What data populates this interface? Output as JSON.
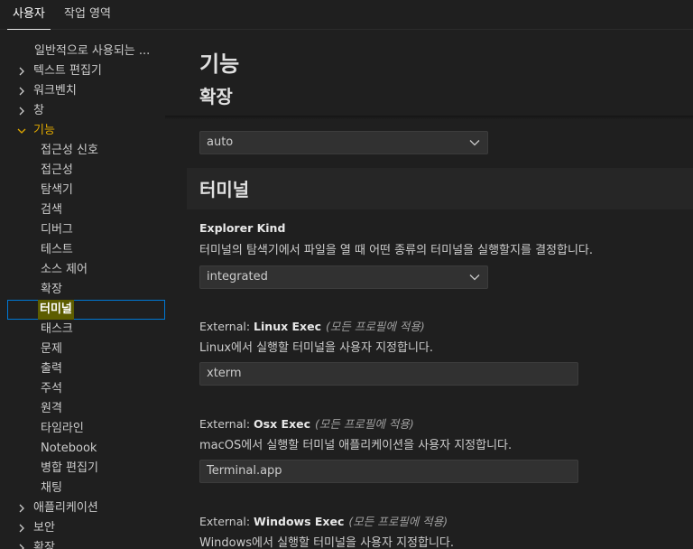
{
  "tabs": [
    {
      "label": "사용자"
    },
    {
      "label": "작업 영역"
    }
  ],
  "toc": {
    "items": [
      {
        "label": "일반적으로 사용되는 ...",
        "chevron": "none"
      },
      {
        "label": "텍스트 편집기",
        "chevron": "right"
      },
      {
        "label": "워크벤치",
        "chevron": "right"
      },
      {
        "label": "창",
        "chevron": "right"
      },
      {
        "label": "기능",
        "chevron": "down"
      },
      {
        "label": "접근성 신호",
        "chevron": "none"
      },
      {
        "label": "접근성",
        "chevron": "none"
      },
      {
        "label": "탐색기",
        "chevron": "none"
      },
      {
        "label": "검색",
        "chevron": "none"
      },
      {
        "label": "디버그",
        "chevron": "none"
      },
      {
        "label": "테스트",
        "chevron": "none"
      },
      {
        "label": "소스 제어",
        "chevron": "none"
      },
      {
        "label": "확장",
        "chevron": "none"
      },
      {
        "label": "터미널",
        "chevron": "none",
        "selected": true
      },
      {
        "label": "태스크",
        "chevron": "none"
      },
      {
        "label": "문제",
        "chevron": "none"
      },
      {
        "label": "출력",
        "chevron": "none"
      },
      {
        "label": "주석",
        "chevron": "none"
      },
      {
        "label": "원격",
        "chevron": "none"
      },
      {
        "label": "타임라인",
        "chevron": "none"
      },
      {
        "label": "Notebook",
        "chevron": "none"
      },
      {
        "label": "병합 편집기",
        "chevron": "none"
      },
      {
        "label": "채팅",
        "chevron": "none"
      },
      {
        "label": "애플리케이션",
        "chevron": "right"
      },
      {
        "label": "보안",
        "chevron": "right"
      },
      {
        "label": "확장",
        "chevron": "right"
      }
    ]
  },
  "content": {
    "page_title": "기능",
    "sticky_section": "확장",
    "prev_select_value": "auto",
    "section_title": "터미널",
    "settings": {
      "explorer_kind": {
        "title": "Explorer Kind",
        "description": "터미널의 탐색기에서 파일을 열 때 어떤 종류의 터미널을 실행할지를 결정합니다.",
        "value": "integrated"
      },
      "linux_exec": {
        "prefix": "External: ",
        "title": "Linux Exec",
        "scope": "(모든 프로필에 적용)",
        "description": "Linux에서 실행할 터미널을 사용자 지정합니다.",
        "value": "xterm"
      },
      "osx_exec": {
        "prefix": "External: ",
        "title": "Osx Exec",
        "scope": "(모든 프로필에 적용)",
        "description": "macOS에서 실행할 터미널 애플리케이션을 사용자 지정합니다.",
        "value": "Terminal.app"
      },
      "windows_exec": {
        "prefix": "External: ",
        "title": "Windows Exec",
        "scope": "(모든 프로필에 적용)",
        "description": "Windows에서 실행할 터미널을 사용자 지정합니다."
      }
    }
  }
}
